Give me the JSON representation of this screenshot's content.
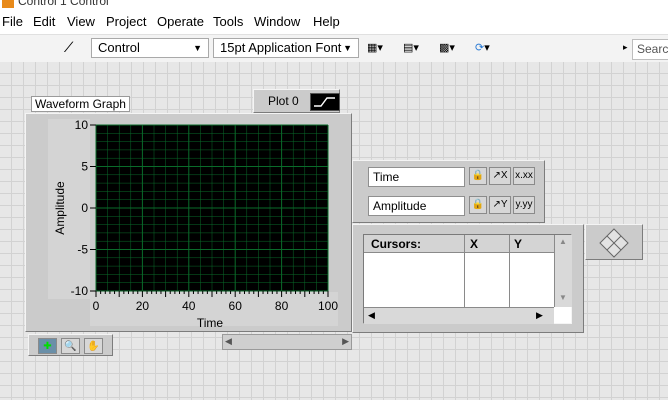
{
  "window": {
    "title": "Control 1 Control"
  },
  "menu": [
    "File",
    "Edit",
    "View",
    "Project",
    "Operate",
    "Tools",
    "Window",
    "Help"
  ],
  "toolbar": {
    "label_select": "Control",
    "font_select": "15pt Application Font",
    "search_placeholder": "Search"
  },
  "graph": {
    "label": "Waveform Graph",
    "plot_legend": "Plot 0",
    "ylabel": "Amplitude",
    "xlabel": "Time"
  },
  "chart_data": {
    "type": "line",
    "title": "Waveform Graph",
    "xlabel": "Time",
    "ylabel": "Amplitude",
    "xlim": [
      0,
      100
    ],
    "ylim": [
      -10,
      10
    ],
    "x_ticks": [
      "0",
      "20",
      "40",
      "60",
      "80",
      "100"
    ],
    "y_ticks": [
      "10",
      "5",
      "0",
      "-5",
      "-10"
    ],
    "grid": true,
    "series": [
      {
        "name": "Plot 0",
        "values": []
      }
    ],
    "colors": {
      "plot_bg": "#000000",
      "grid": "#0a6b2a"
    }
  },
  "scale_legend": {
    "rows": [
      {
        "name": "Time"
      },
      {
        "name": "Amplitude"
      }
    ]
  },
  "cursor_legend": {
    "columns": [
      "Cursors:",
      "X",
      "Y"
    ]
  }
}
